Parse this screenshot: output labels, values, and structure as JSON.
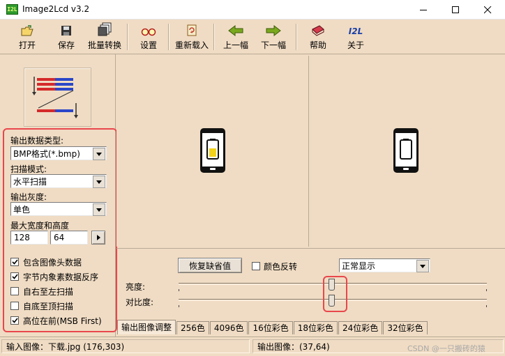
{
  "window": {
    "app_icon_text": "I2L",
    "title": "Image2Lcd v3.2"
  },
  "toolbar": {
    "open": "打开",
    "save": "保存",
    "batch": "批量转换",
    "settings": "设置",
    "reload": "重新载入",
    "prev": "上一幅",
    "next": "下一幅",
    "help": "帮助",
    "about": "关于",
    "about_icon_text": "I2L"
  },
  "left": {
    "output_type_label": "输出数据类型:",
    "output_type_value": "BMP格式(*.bmp)",
    "scan_mode_label": "扫描模式:",
    "scan_mode_value": "水平扫描",
    "gray_label": "输出灰度:",
    "gray_value": "单色",
    "maxsize_label": "最大宽度和高度",
    "max_width": "128",
    "max_height": "64",
    "options": [
      {
        "label": "包含图像头数据",
        "checked": true
      },
      {
        "label": "字节内象素数据反序",
        "checked": true
      },
      {
        "label": "自右至左扫描",
        "checked": false
      },
      {
        "label": "自底至顶扫描",
        "checked": false
      },
      {
        "label": "高位在前(MSB First)",
        "checked": true
      }
    ]
  },
  "adjust": {
    "restore_button": "恢复缺省值",
    "invert_label": "颜色反转",
    "invert_checked": false,
    "display_mode_value": "正常显示",
    "brightness_label": "亮度:",
    "contrast_label": "对比度:",
    "brightness_level": 0.5,
    "contrast_level": 0.5
  },
  "tabs": [
    "输出图像调整",
    "256色",
    "4096色",
    "16位彩色",
    "18位彩色",
    "24位彩色",
    "32位彩色"
  ],
  "status": {
    "input": "输入图像：下载.jpg (176,303)",
    "output": "输出图像：(37,64)",
    "watermark": "CSDN @一只搬砖的猿"
  },
  "colors": {
    "panel_bg": "#f0dcc4",
    "highlight_red": "#e8474b",
    "battery_yellow": "#f2d21a"
  }
}
